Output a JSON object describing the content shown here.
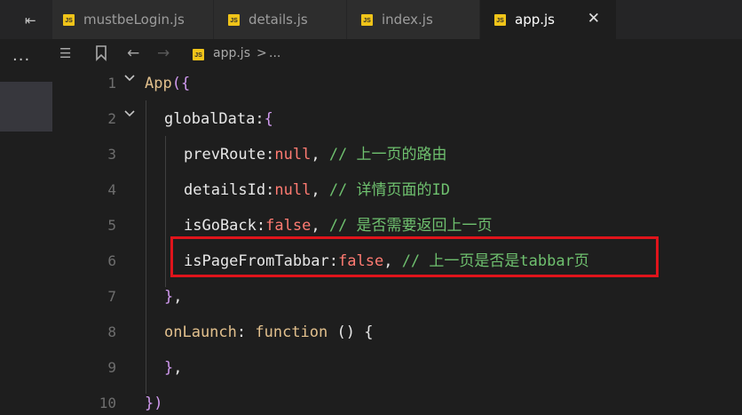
{
  "tabs": [
    {
      "label": "mustbeLogin.js",
      "icon": "js-file-icon",
      "active": false
    },
    {
      "label": "details.js",
      "icon": "js-file-icon",
      "active": false
    },
    {
      "label": "index.js",
      "icon": "js-file-icon",
      "active": false
    },
    {
      "label": "app.js",
      "icon": "js-file-icon",
      "active": true
    }
  ],
  "js_badge": "JS",
  "breadcrumb": {
    "file": "app.js",
    "separator": ">",
    "rest": "..."
  },
  "activity": {
    "more": "..."
  },
  "lines": [
    {
      "n": "1",
      "parts": [
        "App",
        "({"
      ]
    },
    {
      "n": "2",
      "parts": [
        "globalData",
        ":",
        "{"
      ]
    },
    {
      "n": "3",
      "parts": [
        "prevRoute",
        ":",
        "null",
        ", ",
        "// 上一页的路由"
      ]
    },
    {
      "n": "4",
      "parts": [
        "detailsId",
        ":",
        "null",
        ", ",
        "// 详情页面的ID"
      ]
    },
    {
      "n": "5",
      "parts": [
        "isGoBack",
        ":",
        "false",
        ", ",
        "// 是否需要返回上一页"
      ]
    },
    {
      "n": "6",
      "parts": [
        "isPageFromTabbar",
        ":",
        "false",
        ", ",
        "// 上一页是否是tabbar页"
      ]
    },
    {
      "n": "7",
      "parts": [
        "}",
        ","
      ]
    },
    {
      "n": "8",
      "parts": [
        "onLaunch",
        ": ",
        "function",
        " () {"
      ]
    },
    {
      "n": "9",
      "parts": [
        "}",
        ","
      ]
    },
    {
      "n": "10",
      "parts": [
        "})"
      ]
    }
  ],
  "colors": {
    "highlight_box": "#e0141b",
    "comment": "#6fc16f",
    "literal": "#ff7b72"
  }
}
